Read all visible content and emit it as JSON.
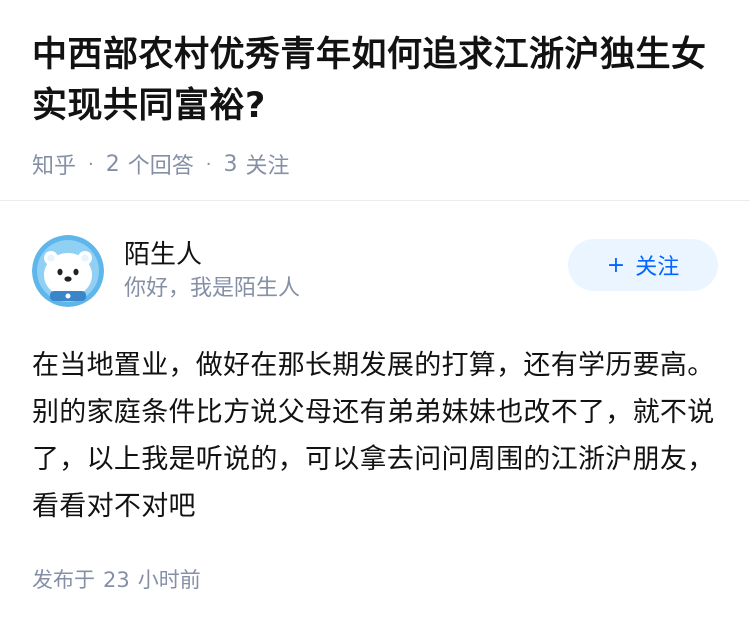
{
  "question": {
    "title": "中西部农村优秀青年如何追求江浙沪独生女实现共同富裕?",
    "source": "知乎",
    "answer_count": "2",
    "answer_label": "个回答",
    "follow_count": "3",
    "follow_label": "关注"
  },
  "answer": {
    "author_name": "陌生人",
    "author_bio": "你好，我是陌生人",
    "follow_button_label": "关注",
    "follow_icon": "plus-icon",
    "content": "在当地置业，做好在那长期发展的打算，还有学历要高。别的家庭条件比方说父母还有弟弟妹妹也改不了，就不说了，以上我是听说的，可以拿去问问周围的江浙沪朋友，看看对不对吧",
    "published_prefix": "发布于",
    "published_num": "23",
    "published_suffix": "小时前"
  },
  "colors": {
    "accent": "#0066ff",
    "accent_bg": "#ebf5ff",
    "meta_gray": "#8590a6",
    "text": "#121212"
  }
}
